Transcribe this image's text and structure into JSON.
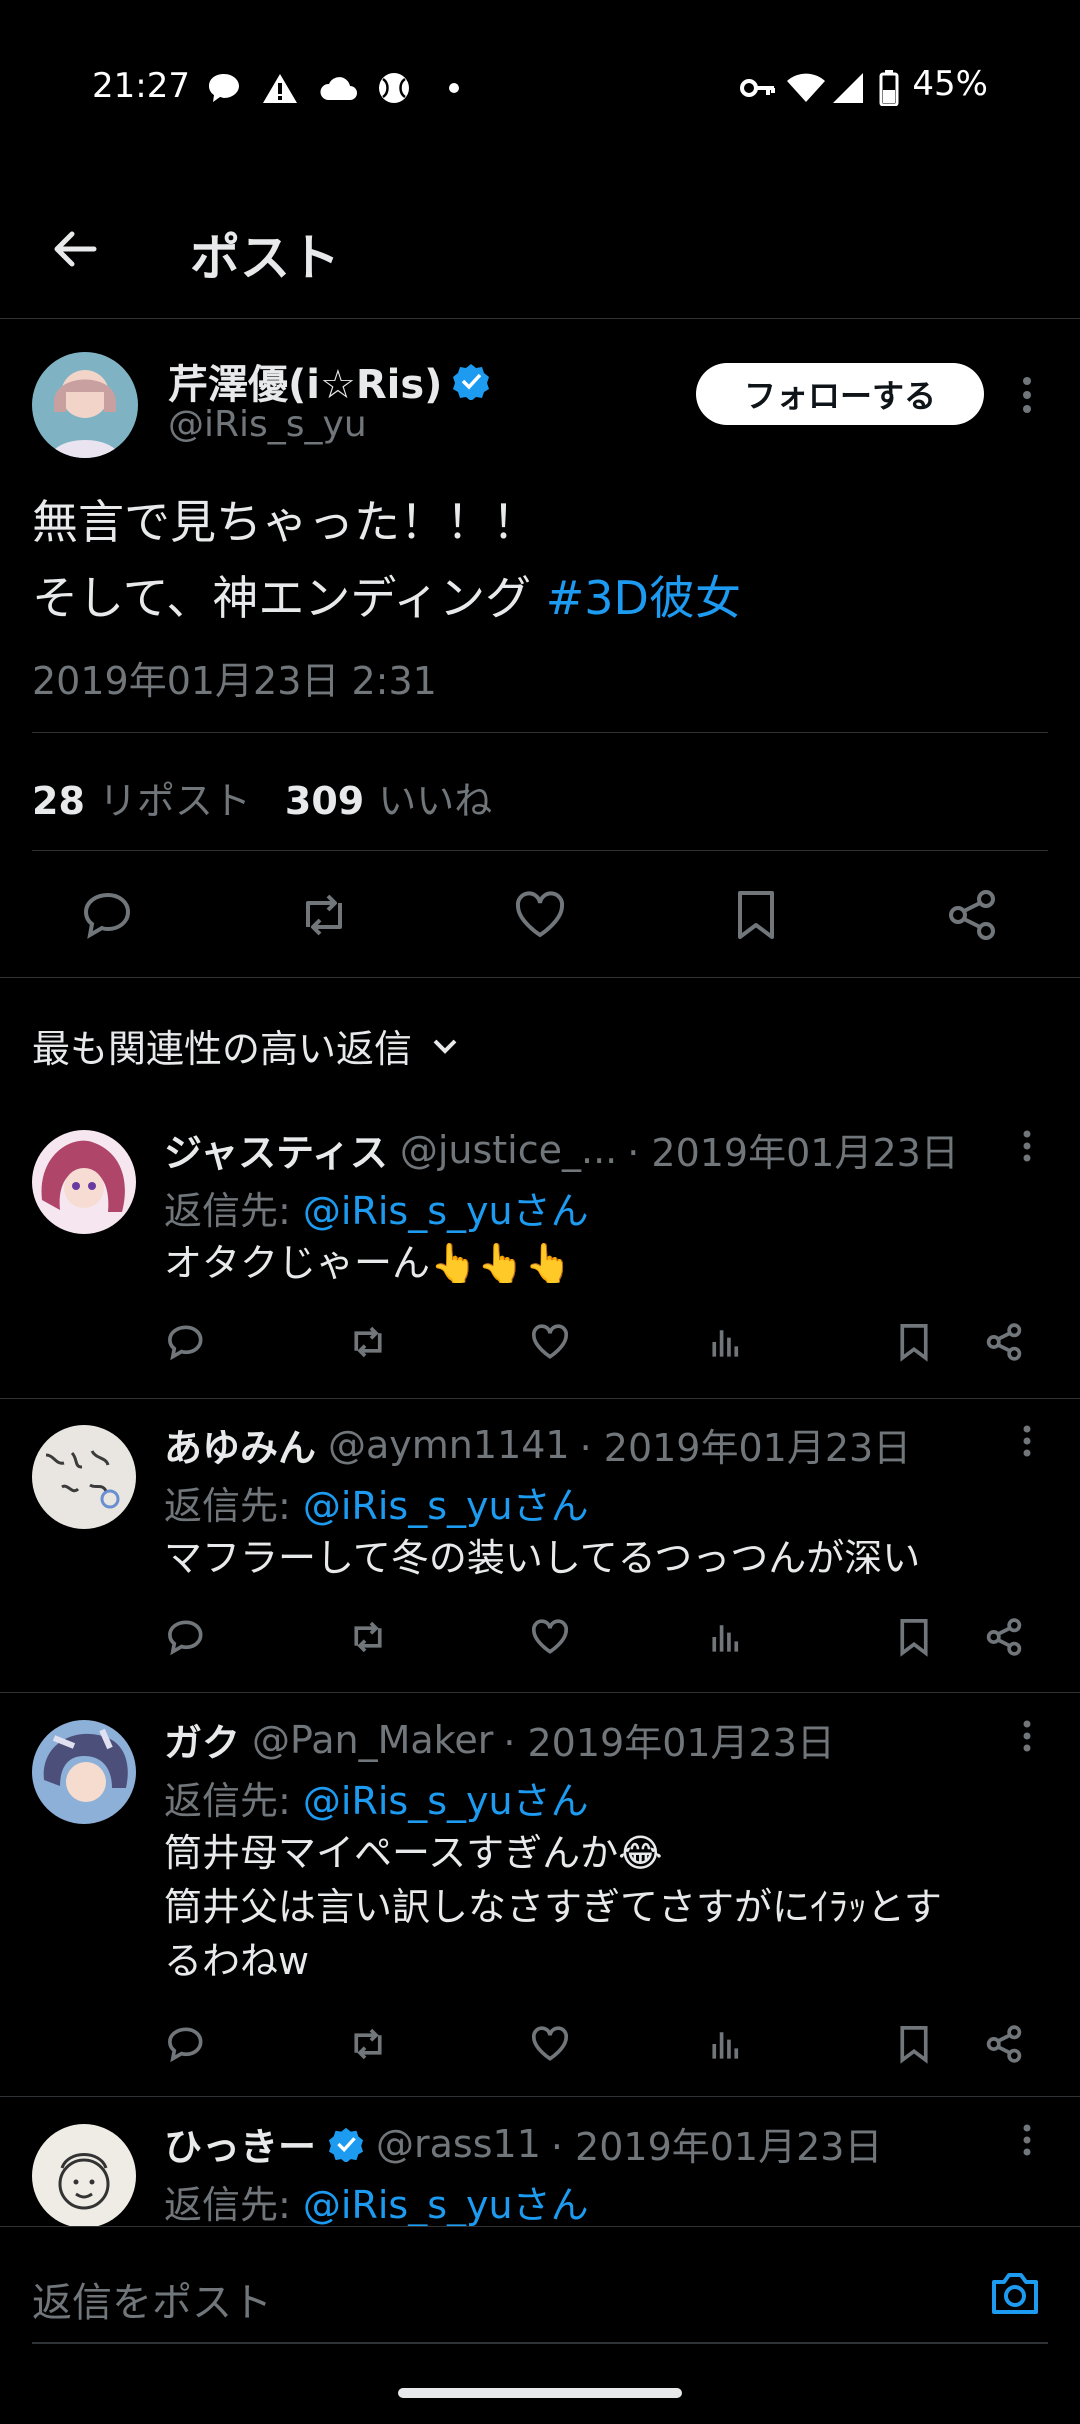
{
  "status_bar": {
    "time": "21:27",
    "battery": "45%",
    "left_icons": [
      "chat-bubble-icon",
      "warning-icon",
      "cloud-icon",
      "ball-icon",
      "dot-icon"
    ],
    "right_icons": [
      "vpn-key-icon",
      "wifi-icon",
      "signal-icon",
      "battery-icon"
    ]
  },
  "header": {
    "title": "ポスト"
  },
  "post": {
    "author_name": "芹澤優(i☆Ris)",
    "author_handle": "@iRis_s_yu",
    "verified": true,
    "follow_label": "フォローする",
    "text_line1": "無言で見ちゃった！！！",
    "text_line2_prefix": "そして、神エンディング ",
    "hashtag": "#3D彼女",
    "timestamp": "2019年01月23日 2:31",
    "reposts_count": "28",
    "reposts_label": "リポスト",
    "likes_count": "309",
    "likes_label": "いいね"
  },
  "sort": {
    "label": "最も関連性の高い返信"
  },
  "replies": [
    {
      "name": "ジャスティス",
      "handle": "@justice_...",
      "date": "· 2019年01月23日",
      "reply_prefix": "返信先: ",
      "reply_to": "@iRis_s_yuさん",
      "text": "オタクじゃーん👆👆👆",
      "avatar_color": "#c05a7a"
    },
    {
      "name": "あゆみん",
      "handle": "@aymn1141",
      "date": "· 2019年01月23日",
      "reply_prefix": "返信先: ",
      "reply_to": "@iRis_s_yuさん",
      "text": "マフラーして冬の装いしてるつっつんが深い",
      "avatar_color": "#dcd8d2"
    },
    {
      "name": "ガク",
      "handle": "@Pan_Maker",
      "date": "· 2019年01月23日",
      "reply_prefix": "返信先: ",
      "reply_to": "@iRis_s_yuさん",
      "text_line1": "筒井母マイペースすぎんか😂",
      "text_line2": "筒井父は言い訳しなさすぎてさすがにｲﾗｯとす",
      "text_line3": "るわねw",
      "avatar_color": "#5b6d9a"
    },
    {
      "name": "ひっきー",
      "handle": "@rass11",
      "date": "· 2019年01月23日",
      "verified": true,
      "reply_prefix": "返信先: ",
      "reply_to": "@iRis_s_yuさん",
      "avatar_color": "#e8e4dc"
    }
  ],
  "compose": {
    "placeholder": "返信をポスト"
  },
  "colors": {
    "accent": "#1d9bf0",
    "background": "#000000",
    "secondary_text": "#71767b",
    "divider": "#2f3336"
  }
}
